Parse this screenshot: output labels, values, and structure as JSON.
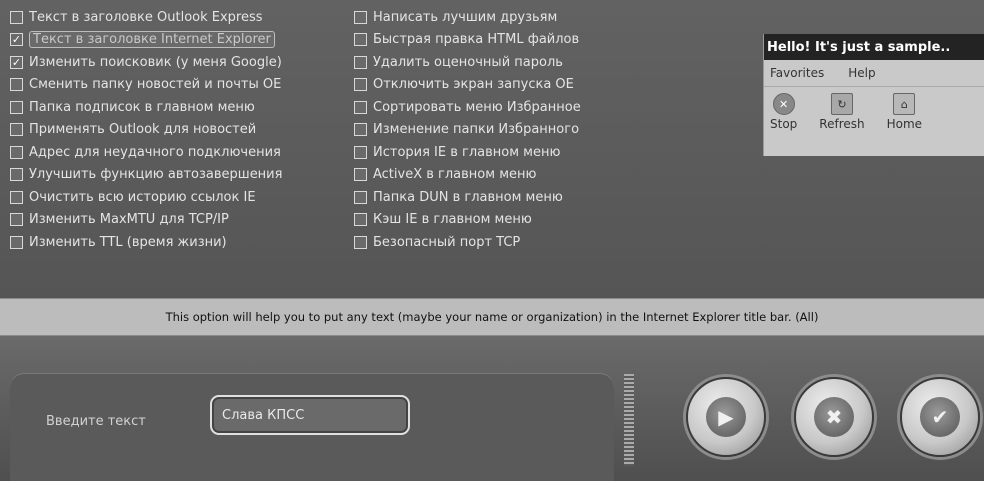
{
  "options_left": [
    {
      "label": "Текст в заголовке Outlook Express",
      "checked": false,
      "selected": false
    },
    {
      "label": "Текст в заголовке Internet Explorer",
      "checked": true,
      "selected": true
    },
    {
      "label": "Изменить поисковик (у меня Google)",
      "checked": true,
      "selected": false
    },
    {
      "label": "Сменить папку новостей и почты OE",
      "checked": false,
      "selected": false
    },
    {
      "label": "Папка подписок в главном меню",
      "checked": false,
      "selected": false
    },
    {
      "label": "Применять Outlook для новостей",
      "checked": false,
      "selected": false
    },
    {
      "label": "Адрес для неудачного подключения",
      "checked": false,
      "selected": false
    },
    {
      "label": "Улучшить функцию автозавершения",
      "checked": false,
      "selected": false
    },
    {
      "label": "Очистить всю историю ссылок IE",
      "checked": false,
      "selected": false
    },
    {
      "label": "Изменить MaxMTU для TCP/IP",
      "checked": false,
      "selected": false
    },
    {
      "label": "Изменить TTL (время жизни)",
      "checked": false,
      "selected": false
    }
  ],
  "options_right": [
    {
      "label": "Написать лучшим друзьям",
      "checked": false
    },
    {
      "label": "Быстрая правка HTML файлов",
      "checked": false
    },
    {
      "label": "Удалить оценочный пароль",
      "checked": false
    },
    {
      "label": "Отключить экран запуска OE",
      "checked": false
    },
    {
      "label": "Сортировать меню Избранное",
      "checked": false
    },
    {
      "label": "Изменение папки Избранного",
      "checked": false
    },
    {
      "label": "История IE в главном меню",
      "checked": false
    },
    {
      "label": "ActiveX в главном меню",
      "checked": false
    },
    {
      "label": "Папка DUN в главном меню",
      "checked": false
    },
    {
      "label": "Кэш IE в главном меню",
      "checked": false
    },
    {
      "label": "Безопасный порт TCP",
      "checked": false
    }
  ],
  "preview": {
    "title": "Hello! It's just a sample..",
    "menu": [
      "Favorites",
      "Help"
    ],
    "toolbar": [
      {
        "label": "Stop",
        "icon": "stop-icon",
        "glyph": "✕"
      },
      {
        "label": "Refresh",
        "icon": "refresh-icon",
        "glyph": "↻"
      },
      {
        "label": "Home",
        "icon": "home-icon",
        "glyph": "⌂"
      }
    ]
  },
  "status_text": "This option will help you to put any text (maybe your name or organization) in the Internet Explorer title bar. (All)",
  "input": {
    "label": "Введите текст",
    "value": "Слава КПСС"
  },
  "buttons": {
    "play_glyph": "▶",
    "cancel_glyph": "✖",
    "ok_glyph": "✔"
  }
}
